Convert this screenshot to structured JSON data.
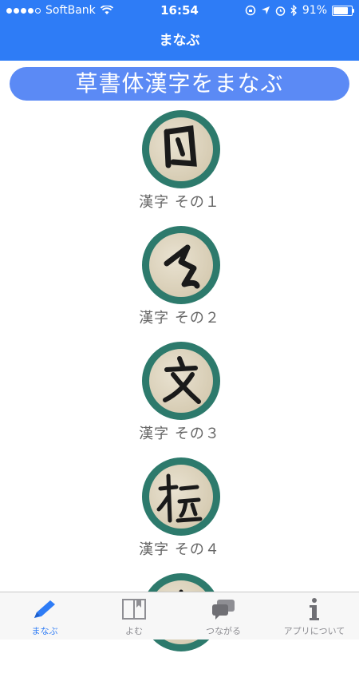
{
  "status_bar": {
    "carrier": "SoftBank",
    "time": "16:54",
    "battery": "91%",
    "battery_level": 0.91
  },
  "nav": {
    "title": "まなぶ"
  },
  "banner": {
    "title": "草書体漢字をまなぶ"
  },
  "items": [
    {
      "label": "漢字 その１",
      "icon": "kanji-sample-1"
    },
    {
      "label": "漢字 その２",
      "icon": "kanji-sample-2"
    },
    {
      "label": "漢字 その３",
      "icon": "kanji-sample-3"
    },
    {
      "label": "漢字 その４",
      "icon": "kanji-sample-4"
    },
    {
      "label": "",
      "icon": "kanji-sample-5"
    }
  ],
  "tabs": [
    {
      "label": "まなぶ",
      "icon": "pencil-icon",
      "active": true
    },
    {
      "label": "よむ",
      "icon": "book-icon",
      "active": false
    },
    {
      "label": "つながる",
      "icon": "chat-bubbles-icon",
      "active": false
    },
    {
      "label": "アプリについて",
      "icon": "info-icon",
      "active": false
    }
  ],
  "colors": {
    "nav_bg": "#2e7cf6",
    "banner_bg": "#5b8af5",
    "circle_border": "#2d7a6c",
    "active_tab": "#2e7cf6"
  }
}
